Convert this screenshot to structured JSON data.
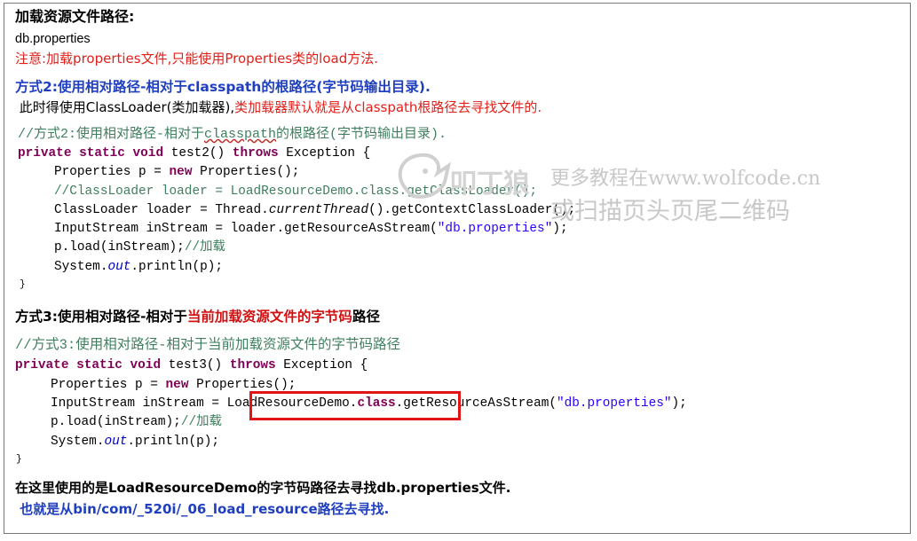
{
  "heading": "加载资源文件路径:",
  "filename": "db.properties",
  "note": "注意:加载properties文件,只能使用Properties类的load方法.",
  "method2_title": "方式2:使用相对路径-相对于classpath的根路径(字节码输出目录).",
  "method2_desc_prefix": " 此时得使用ClassLoader(类加载器),",
  "method2_desc_red": "类加载器默认就是从classpath根路径去寻找文件的.",
  "code2": {
    "comment_a": "//方式2:使用相对路径-相对于",
    "comment_b": "classpath",
    "comment_c": "的根路径(字节码输出目录).",
    "sig_kw": "private static void",
    "sig_name": " test2() ",
    "sig_throws": "throws",
    "sig_exc": " Exception {",
    "l1_a": "Properties p = ",
    "l1_new": "new",
    "l1_b": " Properties();",
    "l2": "//ClassLoader loader = LoadResourceDemo.class.getClassLoader();",
    "l3_a": "ClassLoader loader = Thread.",
    "l3_it": "currentThread",
    "l3_b": "().getContextClassLoader();",
    "l4_a": "InputStream inStream = loader.getResourceAsStream(",
    "l4_str": "\"db.properties\"",
    "l4_b": ");",
    "l5_a": "p.load(inStream);",
    "l5_c": "//加载",
    "l6_a": "System.",
    "l6_fld": "out",
    "l6_b": ".println(p);",
    "close": "}"
  },
  "method3_title_a": "方式3:使用相对路径-相对于",
  "method3_title_red": "当前加载资源文件的字节码",
  "method3_title_b": "路径",
  "code3": {
    "comment": "//方式3:使用相对路径-相对于当前加载资源文件的字节码路径",
    "sig_kw": "private static void",
    "sig_name": " test3() ",
    "sig_throws": "throws",
    "sig_exc": " Exception {",
    "l1_a": "Properties p = ",
    "l1_new": "new",
    "l1_b": " Properties();",
    "l2_a": "InputStream inStream = ",
    "l2_box": "LoadResourceDemo.",
    "l2_kw": "class",
    "l2_b": ".getResourceAsStream(",
    "l2_str": "\"db.properties\"",
    "l2_c": ");",
    "l3_a": "p.load(inStream);",
    "l3_c": "//加载",
    "l4_a": "System.",
    "l4_fld": "out",
    "l4_b": ".println(p);",
    "close": "}"
  },
  "footer1": "在这里使用的是LoadResourceDemo的字节码路径去寻找db.properties文件.",
  "footer2": " 也就是从bin/com/_520i/_06_load_resource路径去寻找.",
  "watermark": {
    "line1": "更多教程在www.wolfcode.cn",
    "line2": "或扫描页头页尾二维码",
    "logo_text": "叩丁狼"
  },
  "colors": {
    "keyword": "#7f0055",
    "comment": "#3f7f5f",
    "string": "#2a00ff",
    "blue_heading": "#1f3fbf",
    "red_note": "#e0201a",
    "highlight_box": "#e01515"
  }
}
